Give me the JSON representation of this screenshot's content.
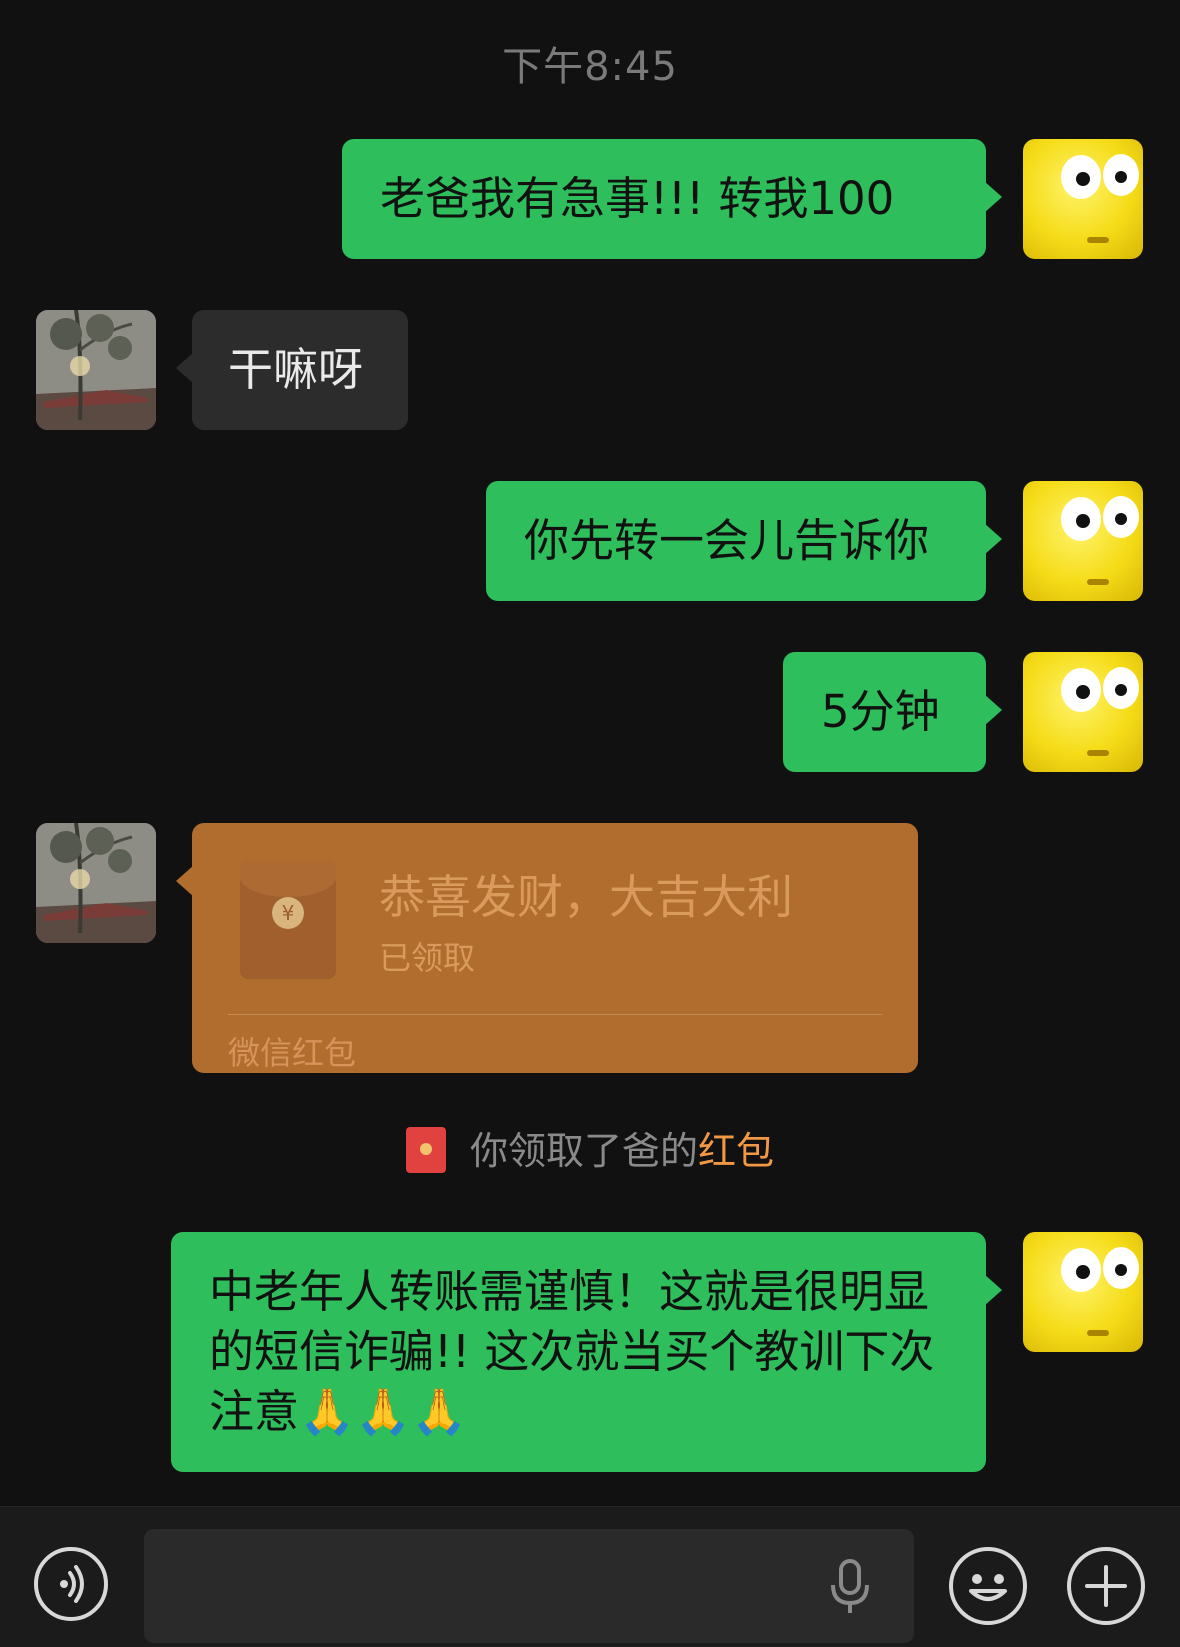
{
  "header": {
    "time": "下午8:45"
  },
  "messages": [
    {
      "from": "me",
      "text": "老爸我有急事!!! 转我100"
    },
    {
      "from": "dad",
      "text": "干嘛呀"
    },
    {
      "from": "me",
      "text": "你先转一会儿告诉你"
    },
    {
      "from": "me",
      "text": "5分钟"
    },
    {
      "from": "dad",
      "type": "red_packet",
      "title": "恭喜发财，大吉大利",
      "status": "已领取",
      "footer": "微信红包"
    },
    {
      "from": "me",
      "text": "中老年人转账需谨慎！这就是很明显的短信诈骗!! 这次就当买个教训下次注意🙏🙏🙏"
    }
  ],
  "system_notice": {
    "prefix": "你领取了爸的",
    "highlight": "红包"
  },
  "input_bar": {
    "voice_icon": "voice-icon",
    "mic_icon": "microphone-icon",
    "emoji_icon": "emoji-icon",
    "plus_icon": "plus-icon"
  },
  "colors": {
    "outgoing_bubble": "#2ebe5c",
    "incoming_bubble": "#2c2c2c",
    "red_packet": "#b06d2e",
    "background": "#111111"
  }
}
